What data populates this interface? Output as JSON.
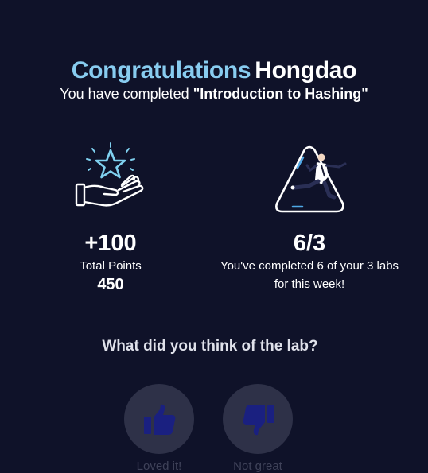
{
  "header": {
    "congrats": "Congratulations",
    "user_name": "Hongdao",
    "subtitle_prefix": "You have completed ",
    "lab_name": "\"Introduction to Hashing\""
  },
  "points": {
    "icon": "hand-star-icon",
    "gained": "+100",
    "label": "Total Points",
    "total": "450"
  },
  "weekly": {
    "icon": "runner-triangle-icon",
    "progress": "6/3",
    "message": "You've completed 6 of your 3 labs for this week!"
  },
  "feedback": {
    "question": "What did you think of the lab?",
    "up_label": "Loved it!",
    "down_label": "Not great",
    "up_icon": "thumbs-up-icon",
    "down_icon": "thumbs-down-icon"
  },
  "colors": {
    "background": "#0f1229",
    "accent": "#88ccf0",
    "button_bg": "#2e3148",
    "button_icon": "#1a2080"
  }
}
